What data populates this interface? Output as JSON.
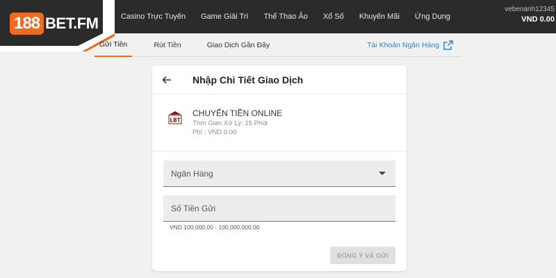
{
  "brand": {
    "badge": "188",
    "suffix": "BET.FM"
  },
  "nav": {
    "items": [
      "Casino Trực Tuyến",
      "Game Giải Trí",
      "Thể Thao Ảo",
      "Xổ Số",
      "Khuyến Mãi",
      "Ứng Dụng"
    ]
  },
  "account": {
    "username": "vebenanh12345",
    "balance": "VND 0.00"
  },
  "tabs": {
    "deposit": "Gửi Tiền",
    "withdraw": "Rút Tiền",
    "history": "Giao Dịch Gần Đây",
    "bank_account": "Tài Khoản Ngân Hàng"
  },
  "card": {
    "title": "Nhập Chi Tiết Giao Dịch",
    "method": {
      "icon_text": "LBT",
      "name": "CHUYỂN TIỀN ONLINE",
      "processing": "Thời Gian Xử Lý: 15 Phút",
      "fee": "Phí : VND 0.00"
    },
    "bank_field": {
      "placeholder": "Ngân Hàng"
    },
    "amount_field": {
      "placeholder": "Số Tiền Gửi"
    },
    "amount_hint": "VND 100,000.00 - 100,000,000.00",
    "submit_label": "ĐỒNG Ý VÀ GỬI"
  },
  "colors": {
    "accent": "#f26b1d",
    "link": "#1a8ad4",
    "header_bg": "#2b2b2b"
  }
}
